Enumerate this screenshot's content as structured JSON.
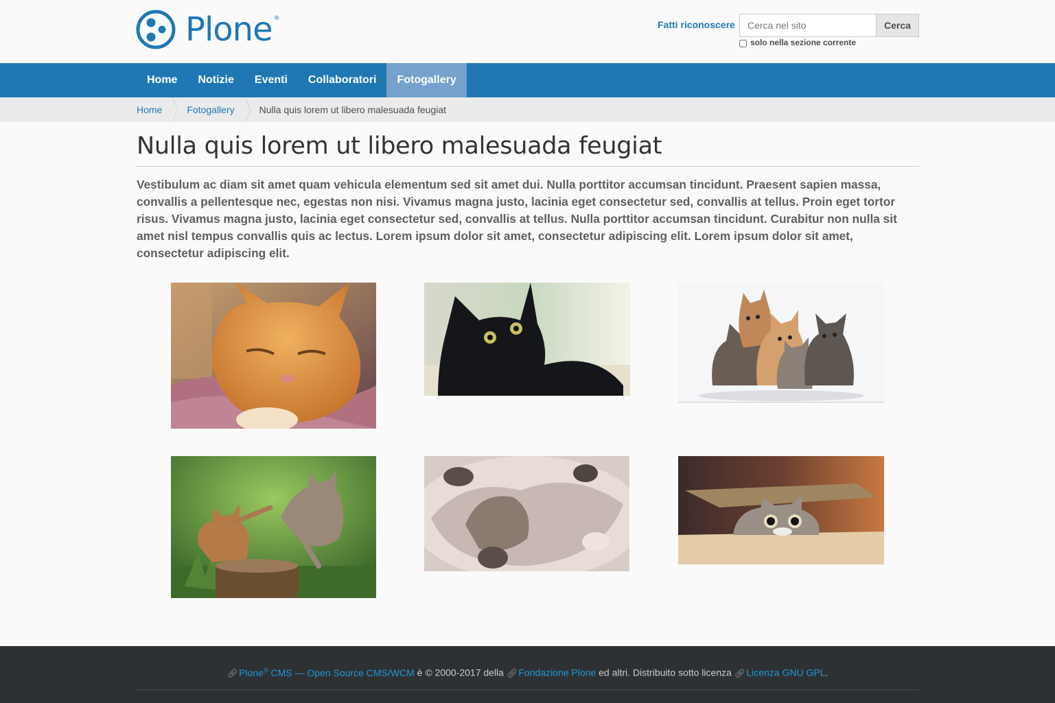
{
  "colors": {
    "brand": "#1f78b4",
    "nav_active": "#75a1cc",
    "footer_bg": "#2e3133",
    "footer_link": "#1f97d9"
  },
  "site": {
    "logo_text": "Plone",
    "logo_mark": "®"
  },
  "header": {
    "login_label": "Fatti riconoscere",
    "search_placeholder": "Cerca nel sito",
    "search_button": "Cerca",
    "search_option": "solo nella sezione corrente"
  },
  "nav": {
    "items": [
      {
        "label": "Home"
      },
      {
        "label": "Notizie"
      },
      {
        "label": "Eventi"
      },
      {
        "label": "Collaboratori"
      },
      {
        "label": "Fotogallery",
        "active": true
      }
    ]
  },
  "breadcrumb": {
    "items": [
      "Home",
      "Fotogallery"
    ],
    "current": "Nulla quis lorem ut libero malesuada feugiat"
  },
  "page": {
    "title": "Nulla quis lorem ut libero malesuada feugiat",
    "description": "Vestibulum ac diam sit amet quam vehicula elementum sed sit amet dui. Nulla porttitor accumsan tincidunt. Praesent sapien massa, convallis a pellentesque nec, egestas non nisi. Vivamus magna justo, lacinia eget consectetur sed, convallis at tellus. Proin eget tortor risus. Vivamus magna justo, lacinia eget consectetur sed, convallis at tellus. Nulla porttitor accumsan tincidunt. Curabitur non nulla sit amet nisl tempus convallis quis ac lectus. Lorem ipsum dolor sit amet, consectetur adipiscing elit. Lorem ipsum dolor sit amet, consectetur adipiscing elit."
  },
  "gallery": {
    "images": [
      {
        "subject": "orange tabby cat on pink blanket"
      },
      {
        "subject": "black cat lying down"
      },
      {
        "subject": "five kittens sitting on white"
      },
      {
        "subject": "two kittens playing on tree stump"
      },
      {
        "subject": "fluffy kitten lying on back"
      },
      {
        "subject": "cat peeking from cardboard box"
      }
    ]
  },
  "footer": {
    "plone_link": "Plone",
    "plone_reg": "®",
    "cms_link": " CMS — Open Source CMS/WCM",
    "text_a": " è © 2000-2017 della ",
    "foundation_link": "Fondazione Plone",
    "text_b": " ed altri. Distribuito sotto licenza ",
    "license_link": "Licenza GNU GPL",
    "text_c": "."
  }
}
